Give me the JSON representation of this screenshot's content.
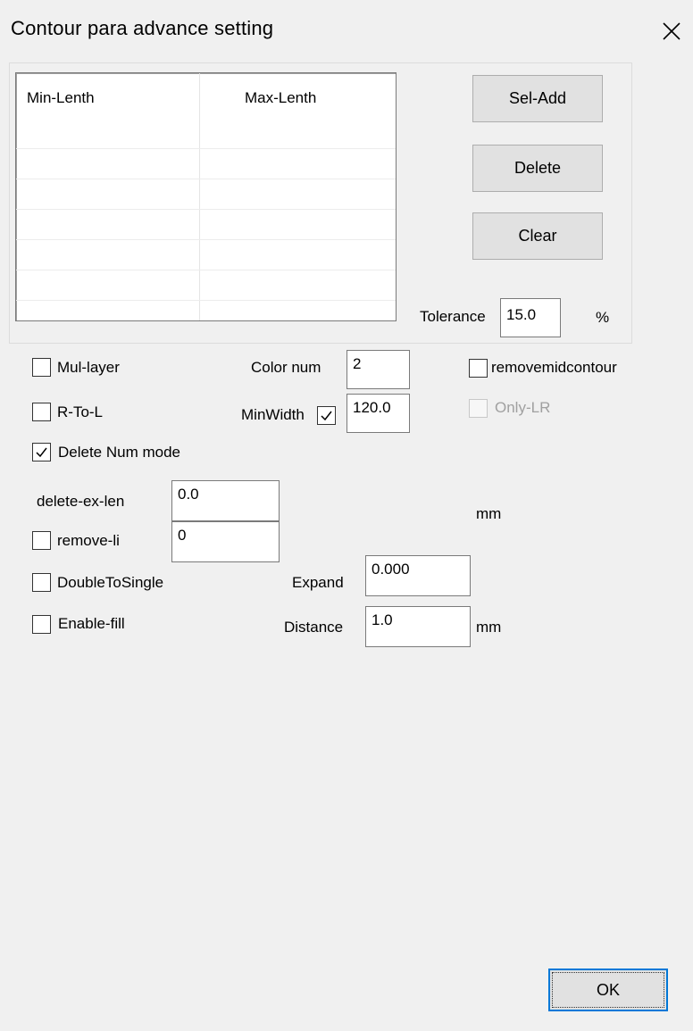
{
  "dialog": {
    "title": "Contour para advance setting",
    "close_icon": "close-icon"
  },
  "list": {
    "columns": [
      "Min-Lenth",
      "Max-Lenth"
    ],
    "rows": []
  },
  "buttons": {
    "sel_add": "Sel-Add",
    "delete": "Delete",
    "clear": "Clear",
    "ok": "OK"
  },
  "tolerance": {
    "label": "Tolerance",
    "value": "15.0",
    "unit": "%"
  },
  "options": {
    "mul_layer": {
      "label": "Mul-layer",
      "checked": false
    },
    "r_to_l": {
      "label": "R-To-L",
      "checked": false
    },
    "delete_num_mode": {
      "label": "Delete Num mode",
      "checked": true
    },
    "remove_li": {
      "label": "remove-li",
      "checked": false
    },
    "double_to_single": {
      "label": "DoubleToSingle",
      "checked": false
    },
    "enable_fill": {
      "label": "Enable-fill",
      "checked": false
    },
    "remove_mid_contour": {
      "label": "removemidcontour",
      "checked": false
    },
    "only_lr": {
      "label": "Only-LR",
      "checked": false,
      "disabled": true
    },
    "min_width_check": {
      "checked": true
    }
  },
  "fields": {
    "color_num": {
      "label": "Color num",
      "value": "2"
    },
    "min_width": {
      "label": "MinWidth",
      "value": "120.0"
    },
    "delete_ex_len": {
      "label": "delete-ex-len",
      "value": "0.0"
    },
    "remove_li_value": {
      "value": "0"
    },
    "ex_len_unit": "mm",
    "expand": {
      "label": "Expand",
      "value": "0.000"
    },
    "distance": {
      "label": "Distance",
      "value": "1.0",
      "unit": "mm"
    }
  },
  "colors": {
    "focus_border": "#0078d7",
    "button_face": "#e1e1e1",
    "window_bg": "#f0f0f0"
  }
}
